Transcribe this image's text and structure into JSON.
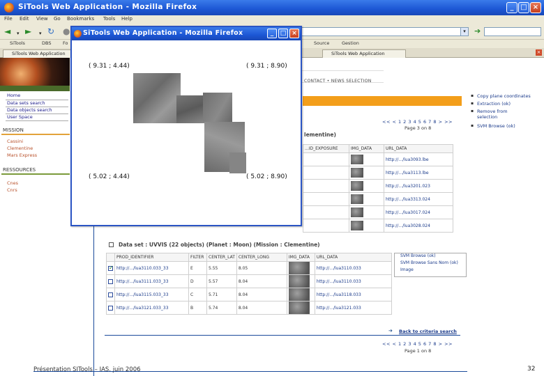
{
  "main_window": {
    "title": "SiTools Web Application - Mozilla Firefox",
    "menu": [
      "File",
      "Edit",
      "View",
      "Go",
      "Bookmarks",
      "Tools",
      "Help"
    ],
    "bookmarks": [
      "SiTools",
      "DBS",
      "Fo",
      "Source",
      "Gestion"
    ],
    "tabs": [
      "SiTools Web Application",
      "SiTools Web Application"
    ]
  },
  "left_nav": {
    "links": [
      "Home",
      "Data sets search",
      "Data objects search",
      "User Space"
    ],
    "mission_heading": "MISSION",
    "missions": [
      "Cassini",
      "Clementine",
      "Mars Express"
    ],
    "resources_heading": "RESSOURCES",
    "resources": [
      "Cnes",
      "Cnrs"
    ]
  },
  "header": {
    "contact": "CONTACT  •  NEWS SELECTION"
  },
  "right_links": [
    "Copy plane coordinates",
    "Extraction (ok)",
    "Remove from selection",
    "SVM Browse (ok)"
  ],
  "pager": {
    "top": "<< < 1 2 3 4 5 6 7 8 > >>",
    "top_info": "Page 3 on 8",
    "bottom": "<< < 1 2 3 4 5 6 7 8 > >>",
    "bottom_info": "Page 1 on 8"
  },
  "dataset1": {
    "title_tail": "lementine)",
    "columns": [
      "...ID_EXPOSURE",
      "IMG_DATA",
      "URL_DATA"
    ],
    "rows": [
      [
        "",
        "",
        "http://.../lua3093.lbe"
      ],
      [
        "",
        "",
        "http://.../lua3113.lbe"
      ],
      [
        "",
        "",
        "http://.../lua3201.023"
      ],
      [
        "",
        "",
        "http://.../lua3313.024"
      ],
      [
        "",
        "",
        "http://.../lua3017.024"
      ],
      [
        "",
        "",
        "http://.../lua3028.024"
      ]
    ]
  },
  "dataset2": {
    "header": "Data set : UVVIS  (22 objects)  (Planet : Moon)  (Mission : Clementine)",
    "columns": [
      "PROD_IDENTIFIER",
      "FILTER",
      "CENTER_LAT",
      "CENTER_LONG",
      "IMG_DATA",
      "URL_DATA"
    ],
    "rows": [
      {
        "checked": true,
        "id": "http://.../lua3110.033_33",
        "filter": "E",
        "lat": "5.55",
        "long": "8.05",
        "url": "http://.../lua3110.033"
      },
      {
        "checked": false,
        "id": "http://.../lua3111.033_33",
        "filter": "D",
        "lat": "5.57",
        "long": "8.04",
        "url": "http://.../lua3110.033"
      },
      {
        "checked": false,
        "id": "http://.../lua3115.033_33",
        "filter": "C",
        "lat": "5.71",
        "long": "8.04",
        "url": "http://.../lua3118.033"
      },
      {
        "checked": false,
        "id": "http://.../lua3121.033_33",
        "filter": "B",
        "lat": "5.74",
        "long": "8.04",
        "url": "http://.../lua3121.033"
      }
    ],
    "menu": [
      "SVM Browse (ok)",
      "SVM Browse Sans Nom (ok)",
      "Image"
    ]
  },
  "back_link": "Back to criteria search",
  "popup": {
    "title": "SiTools Web Application - Mozilla Firefox",
    "coords": {
      "top_left": "( 9.31 ; 4.44)",
      "top_right": "( 9.31 ; 8.90)",
      "bottom_left": "( 5.02 ; 4.44)",
      "bottom_right": "( 5.02 ; 8.90)"
    }
  },
  "footer": {
    "text": "Présentation SITools – IAS, juin 2006",
    "page": "32"
  }
}
